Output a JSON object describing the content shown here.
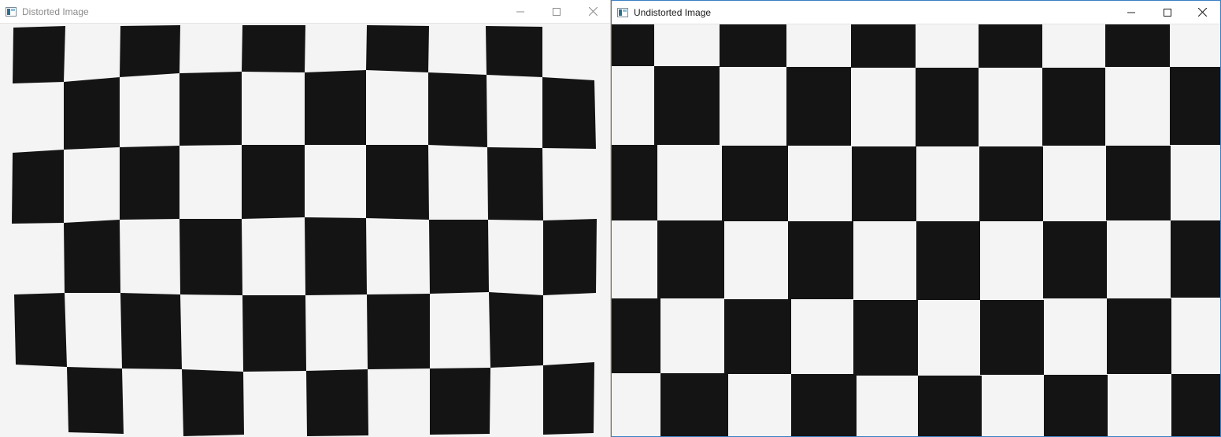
{
  "windows": [
    {
      "title": "Distorted Image",
      "active": false,
      "controls": {
        "minimize": "minimize-icon",
        "maximize": "maximize-icon",
        "close": "close-icon"
      }
    },
    {
      "title": "Undistorted Image",
      "active": true,
      "controls": {
        "minimize": "minimize-icon",
        "maximize": "maximize-icon",
        "close": "close-icon"
      }
    }
  ],
  "colors": {
    "square_dark": "#141414",
    "paper": "#f4f4f4",
    "active_border": "#3b7fc4"
  }
}
